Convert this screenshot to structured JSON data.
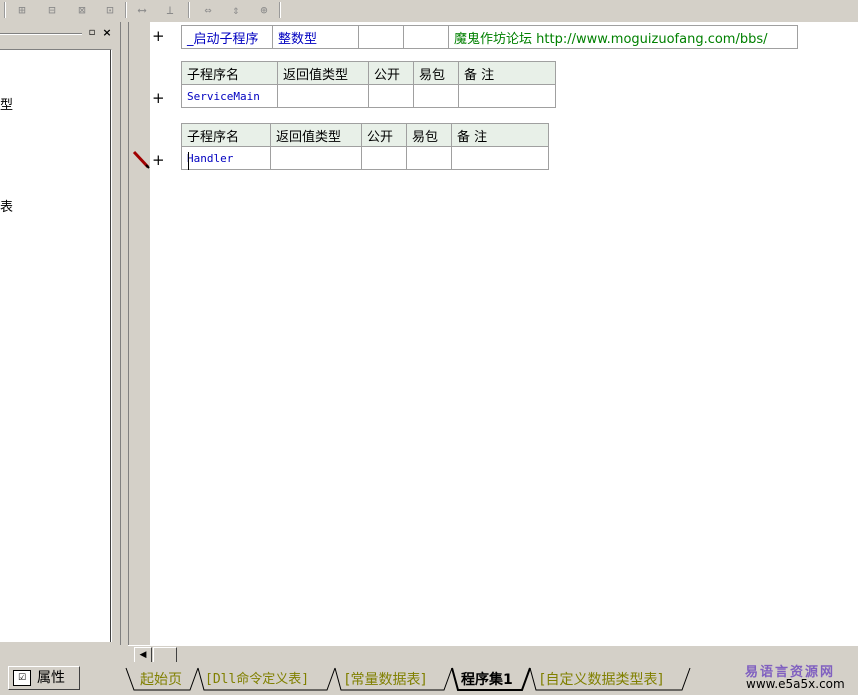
{
  "editor": {
    "program_row": {
      "name": "_启动子程序",
      "type": "整数型",
      "note": "魔鬼作坊论坛 http://www.moguizuofang.com/bbs/"
    },
    "sub_headers": [
      "子程序名",
      "返回值类型",
      "公开",
      "易包",
      "备 注"
    ],
    "sub1": {
      "name": "ServiceMain"
    },
    "sub2": {
      "name": "Handler"
    },
    "plus": "+"
  },
  "left_panel": {
    "text1": "型",
    "text2": "表"
  },
  "properties_tab": {
    "label": "属性"
  },
  "tabs": [
    "起始页",
    "[Dll命令定义表]",
    "[常量数据表]",
    "程序集1",
    "[自定义数据类型表]"
  ],
  "watermark": {
    "line1": "易语言资源网",
    "line2": "www.e5a5x.com"
  },
  "colors": {
    "active_tab": "#000000",
    "inactive_tab": "#808000",
    "program_name": "#0000c0",
    "note_text": "#008000"
  }
}
